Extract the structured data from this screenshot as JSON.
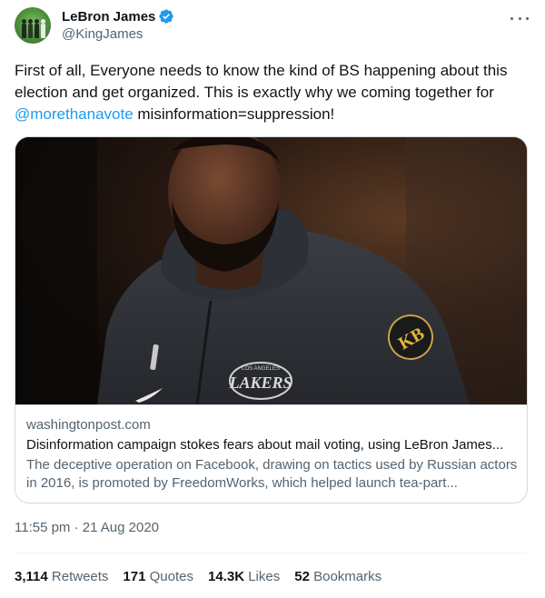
{
  "author": {
    "display_name": "LeBron James",
    "handle": "@KingJames",
    "avatar_icon": "avatar-photo",
    "verified_icon": "verified-badge-icon",
    "verified_color": "#1d9bf0"
  },
  "tweet": {
    "text_before": "First of all, Everyone needs to know the kind of BS happening about this election and get organized. This is exactly why we coming together for ",
    "mention": "@morethanavote",
    "text_after": " misinformation=suppression!",
    "timestamp": "11:55 pm · 21 Aug 2020"
  },
  "link_card": {
    "domain": "washingtonpost.com",
    "headline": "Disinformation campaign stokes fears about mail voting, using LeBron James...",
    "description": "The deceptive operation on Facebook, drawing on tactics used by Russian actors in 2016, is promoted by FreedomWorks, which helped launch tea-part...",
    "jersey_text": "LAKERS",
    "jersey_small_text": "LOS ANGELES",
    "patch_text": "KB"
  },
  "stats": {
    "retweets_count": "3,114",
    "retweets_label": "Retweets",
    "quotes_count": "171",
    "quotes_label": "Quotes",
    "likes_count": "14.3K",
    "likes_label": "Likes",
    "bookmarks_count": "52",
    "bookmarks_label": "Bookmarks"
  },
  "colors": {
    "link": "#1d9bf0",
    "secondary_text": "#536471",
    "primary_text": "#0f1419",
    "border": "#cfd9de"
  }
}
